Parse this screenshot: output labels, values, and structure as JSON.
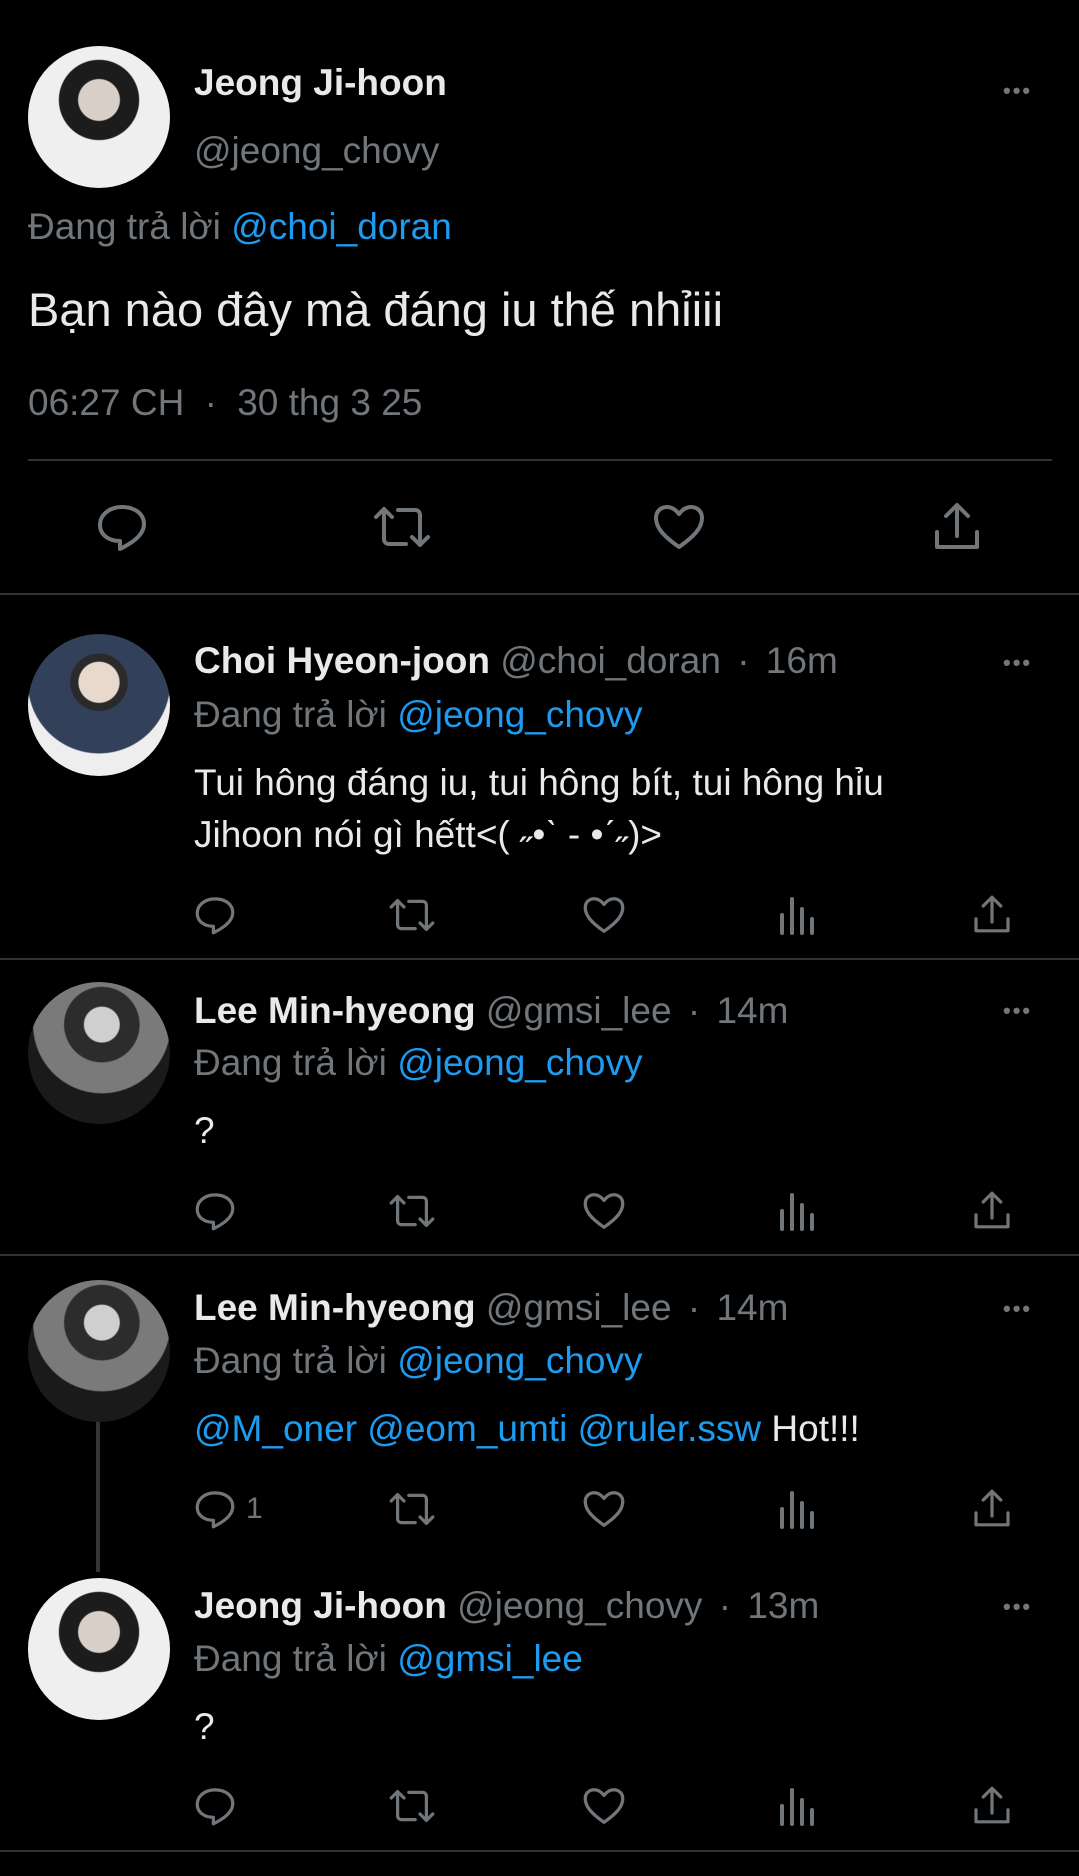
{
  "main_tweet": {
    "display_name": "Jeong Ji-hoon",
    "handle": "@jeong_chovy",
    "reply_prefix": "Đang trả lời",
    "reply_to": "@choi_doran",
    "text": "Bạn nào đây mà đáng iu thế nhỉiii",
    "time": "06:27 CH",
    "separator": "·",
    "date": "30 thg 3 25"
  },
  "replies": [
    {
      "display_name": "Choi Hyeon-joon",
      "handle": "@choi_doran",
      "age": "16m",
      "reply_prefix": "Đang trả lời",
      "reply_to": "@jeong_chovy",
      "text_line1": "Tui hông đáng iu, tui hông bít, tui hông hỉu",
      "text_line2": "Jihoon nói gì hếtt<( ˶•ˋ ‐ •ˊ˶)>"
    },
    {
      "display_name": "Lee Min-hyeong",
      "handle": "@gmsi_lee",
      "age": "14m",
      "reply_prefix": "Đang trả lời",
      "reply_to": "@jeong_chovy",
      "text": "?"
    },
    {
      "display_name": "Lee Min-hyeong",
      "handle": "@gmsi_lee",
      "age": "14m",
      "reply_prefix": "Đang trả lời",
      "reply_to": "@jeong_chovy",
      "mention1": "@M_oner",
      "mention2": "@eom_umti",
      "mention3": "@ruler.ssw",
      "text": "Hot!!!",
      "reply_count": "1"
    },
    {
      "display_name": "Jeong Ji-hoon",
      "handle": "@jeong_chovy",
      "age": "13m",
      "reply_prefix": "Đang trả lời",
      "reply_to": "@gmsi_lee",
      "text": "?"
    }
  ],
  "more_glyph": "•••",
  "dot": "·",
  "icons": [
    "reply-icon",
    "retweet-icon",
    "like-icon",
    "views-icon",
    "share-icon",
    "more-icon"
  ],
  "colors": {
    "background": "#000000",
    "text": "#e7e9ea",
    "muted": "#71767b",
    "link": "#1d9bf0",
    "divider": "#2f3336"
  }
}
